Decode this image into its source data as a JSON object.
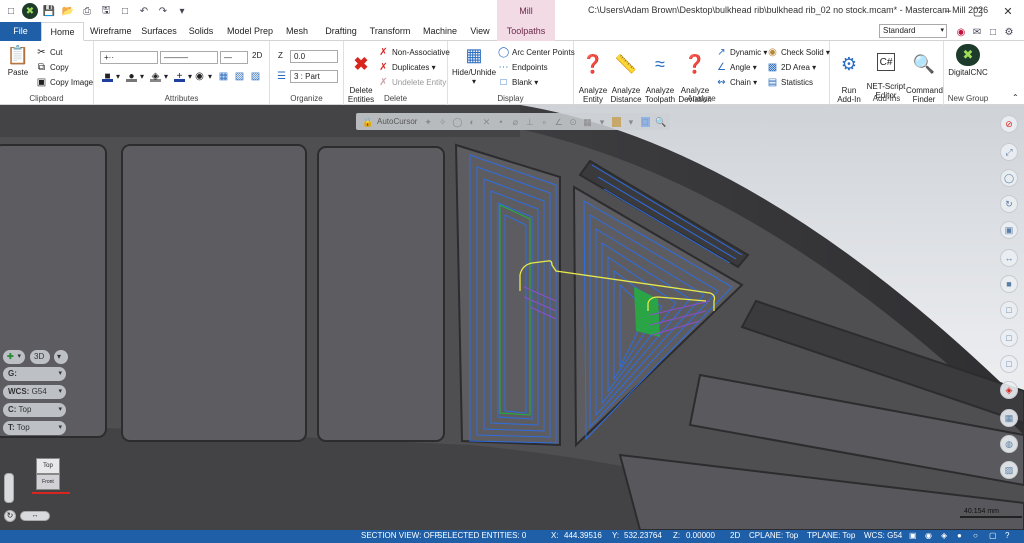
{
  "title_bar": {
    "document_title": "C:\\Users\\Adam Brown\\Desktop\\bulkhead rib\\bulkhead rib_02 no stock.mcam* - Mastercam Mill 2026",
    "context_tab_group": "Mill"
  },
  "tabs": [
    "File",
    "Home",
    "Wireframe",
    "Surfaces",
    "Solids",
    "Model Prep",
    "Mesh",
    "Drafting",
    "Transform",
    "Machine",
    "View",
    "Toolpaths"
  ],
  "view_combo": "Standard",
  "ribbon": {
    "clipboard": {
      "paste": "Paste",
      "cut": "Cut",
      "copy": "Copy",
      "copy_image": "Copy Image",
      "label": "Clipboard"
    },
    "attributes": {
      "mode": "2D",
      "label": "Attributes"
    },
    "organize": {
      "z_label": "Z",
      "z_value": "0.0",
      "level": "3 : Part",
      "label": "Organize"
    },
    "delete": {
      "delete_entities": "Delete\nEntities",
      "non_associative": "Non-Associative",
      "duplicates": "Duplicates",
      "undelete": "Undelete Entity",
      "label": "Delete"
    },
    "display": {
      "hide_unhide": "Hide/Unhide",
      "arc_center_points": "Arc Center Points",
      "endpoints": "Endpoints",
      "blank": "Blank",
      "label": "Display"
    },
    "analyze": {
      "analyze_entity": "Analyze\nEntity",
      "analyze_distance": "Analyze\nDistance",
      "analyze_toolpath": "Analyze\nToolpath",
      "analyze_deviation": "Analyze\nDeviation",
      "dynamic": "Dynamic",
      "angle": "Angle",
      "chain": "Chain",
      "check_solid": "Check Solid",
      "area_2d": "2D Area",
      "statistics": "Statistics",
      "label": "Analyze"
    },
    "addins": {
      "run_addin": "Run\nAdd-In",
      "net_script": "NET-Script\nEditor",
      "command_finder": "Command\nFinder",
      "label": "Add-Ins"
    },
    "new_group": {
      "digitalcnc": "DigitalCNC",
      "label": "New Group"
    }
  },
  "viewport": {
    "autocursor": "AutoCursor",
    "left_controls": [
      {
        "key": "G:",
        "value": ""
      },
      {
        "key": "WCS:",
        "value": "G54"
      },
      {
        "key": "C:",
        "value": "Top"
      },
      {
        "key": "T:",
        "value": "Top"
      }
    ],
    "mode_3d": "3D",
    "viewcube_top": "Top",
    "viewcube_front": "Front",
    "scale": "40.154 mm"
  },
  "status_bar": {
    "section_view": "SECTION VIEW: OFF",
    "selected": "SELECTED ENTITIES: 0",
    "x_label": "X:",
    "x_value": "444.39516",
    "y_label": "Y:",
    "y_value": "532.23764",
    "z_label": "Z:",
    "z_value": "0.00000",
    "mode": "2D",
    "cplane": "CPLANE: Top",
    "tplane": "TPLANE: Top",
    "wcs": "WCS: G54"
  },
  "colors": {
    "accent": "#1e5fa8",
    "toolpath": "#2e6de0",
    "rapid": "#e8e84a",
    "entry": "#22b040",
    "part": "#4f4f52"
  }
}
